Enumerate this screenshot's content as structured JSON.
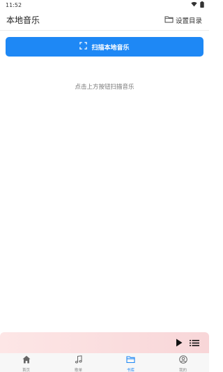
{
  "status_bar": {
    "time": "11:52"
  },
  "header": {
    "title": "本地音乐",
    "set_dir_label": "设置目录"
  },
  "main": {
    "scan_button_label": "扫描本地音乐",
    "hint": "点击上方按钮扫描音乐"
  },
  "nav": {
    "items": [
      {
        "label": "首页",
        "icon": "home-icon"
      },
      {
        "label": "歌单",
        "icon": "music-note-icon"
      },
      {
        "label": "书库",
        "icon": "folder-icon"
      },
      {
        "label": "我的",
        "icon": "user-icon"
      }
    ],
    "active_index": 2
  },
  "colors": {
    "accent": "#1e88f5",
    "player_bg": "#f8d6d8"
  }
}
